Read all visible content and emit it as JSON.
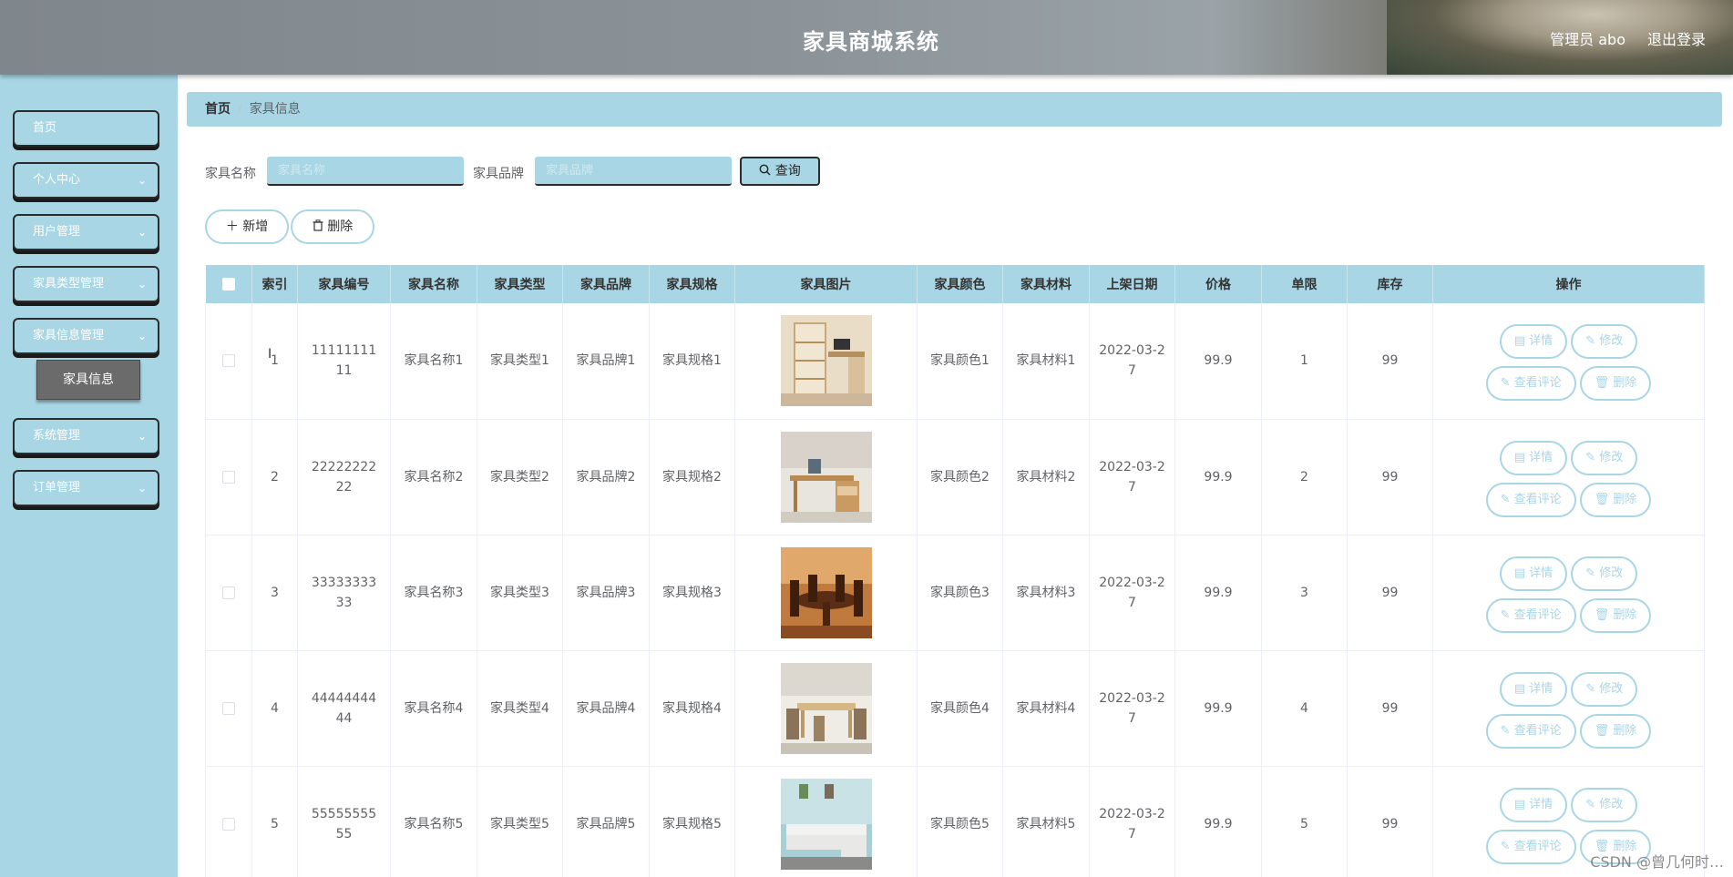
{
  "header": {
    "title": "家具商城系统",
    "user": "管理员 abo",
    "logout": "退出登录"
  },
  "sidebar": {
    "items": [
      {
        "label": "首页",
        "chevron": false
      },
      {
        "label": "个人中心",
        "chevron": true
      },
      {
        "label": "用户管理",
        "chevron": true
      },
      {
        "label": "家具类型管理",
        "chevron": true
      },
      {
        "label": "家具信息管理",
        "chevron": true
      },
      {
        "label": "系统管理",
        "chevron": true
      },
      {
        "label": "订单管理",
        "chevron": true
      }
    ],
    "active_sub": "家具信息"
  },
  "breadcrumb": {
    "home": "首页",
    "current": "家具信息"
  },
  "search": {
    "name_label": "家具名称",
    "name_placeholder": "家具名称",
    "brand_label": "家具品牌",
    "brand_placeholder": "家具品牌",
    "query_label": "查询"
  },
  "actions": {
    "add_label": "新增",
    "delete_label": "删除"
  },
  "table": {
    "columns": [
      "索引",
      "家具编号",
      "家具名称",
      "家具类型",
      "家具品牌",
      "家具规格",
      "家具图片",
      "家具颜色",
      "家具材料",
      "上架日期",
      "价格",
      "单限",
      "库存",
      "操作"
    ],
    "row_buttons": {
      "detail": "详情",
      "edit": "修改",
      "comments": "查看评论",
      "delete": "删除"
    },
    "rows": [
      {
        "index": "1",
        "code": "1111111111",
        "name": "家具名称1",
        "type": "家具类型1",
        "brand": "家具品牌1",
        "spec": "家具规格1",
        "image": "bookshelf-desk-photo",
        "color": "家具颜色1",
        "material": "家具材料1",
        "date": "2022-03-27",
        "price": "99.9",
        "limit": "1",
        "stock": "99"
      },
      {
        "index": "2",
        "code": "2222222222",
        "name": "家具名称2",
        "type": "家具类型2",
        "brand": "家具品牌2",
        "spec": "家具规格2",
        "image": "wooden-desk-photo",
        "color": "家具颜色2",
        "material": "家具材料2",
        "date": "2022-03-27",
        "price": "99.9",
        "limit": "2",
        "stock": "99"
      },
      {
        "index": "3",
        "code": "3333333333",
        "name": "家具名称3",
        "type": "家具类型3",
        "brand": "家具品牌3",
        "spec": "家具规格3",
        "image": "round-dining-table-photo",
        "color": "家具颜色3",
        "material": "家具材料3",
        "date": "2022-03-27",
        "price": "99.9",
        "limit": "3",
        "stock": "99"
      },
      {
        "index": "4",
        "code": "4444444444",
        "name": "家具名称4",
        "type": "家具类型4",
        "brand": "家具品牌4",
        "spec": "家具规格4",
        "image": "dining-set-photo",
        "color": "家具颜色4",
        "material": "家具材料4",
        "date": "2022-03-27",
        "price": "99.9",
        "limit": "4",
        "stock": "99"
      },
      {
        "index": "5",
        "code": "5555555555",
        "name": "家具名称5",
        "type": "家具类型5",
        "brand": "家具品牌5",
        "spec": "家具规格5",
        "image": "sofa-photo",
        "color": "家具颜色5",
        "material": "家具材料5",
        "date": "2022-03-27",
        "price": "99.9",
        "limit": "5",
        "stock": "99"
      }
    ]
  },
  "watermark": "CSDN @曾几何时…",
  "colors": {
    "accent": "#a9d6e5",
    "submenu": "#6b6b6b",
    "header": "#8b9399"
  }
}
